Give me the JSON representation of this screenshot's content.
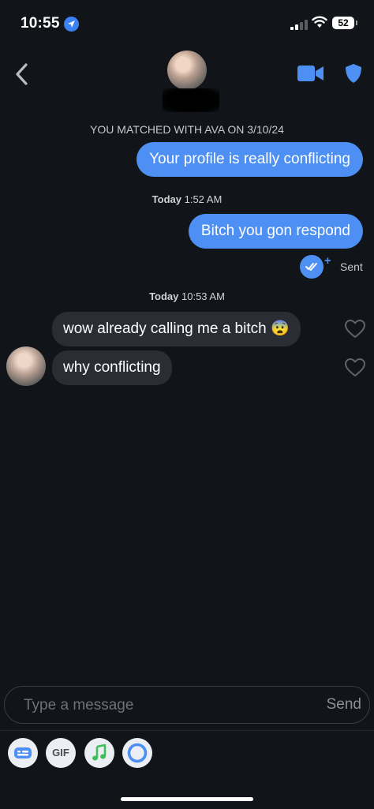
{
  "status_bar": {
    "time": "10:55",
    "battery": "52"
  },
  "header": {
    "back_icon": "chevron-left-icon",
    "video_icon": "video-camera-icon",
    "safety_icon": "shield-icon"
  },
  "match_banner": "YOU MATCHED WITH AVA ON 3/10/24",
  "messages": [
    {
      "text": "Your profile is really conflicting"
    },
    {
      "stamp_day": "Today",
      "stamp_time": " 1:52 AM"
    },
    {
      "text": "Bitch you gon respond"
    },
    {
      "status": "Sent"
    },
    {
      "stamp_day": "Today",
      "stamp_time": " 10:53 AM"
    },
    {
      "text": "wow already calling me a bitch 😨"
    },
    {
      "text": "why conflicting"
    }
  ],
  "composer": {
    "placeholder": "Type a message",
    "send_label": "Send"
  },
  "toolbar": {
    "gif_label": "GIF",
    "icons": [
      "sticker-card-icon",
      "gif-icon",
      "music-note-icon",
      "circle-icon"
    ]
  },
  "colors": {
    "accent": "#4d8ff3",
    "background": "#111418",
    "incoming_bubble": "#2a2d33",
    "music_green": "#3fbf5a"
  }
}
